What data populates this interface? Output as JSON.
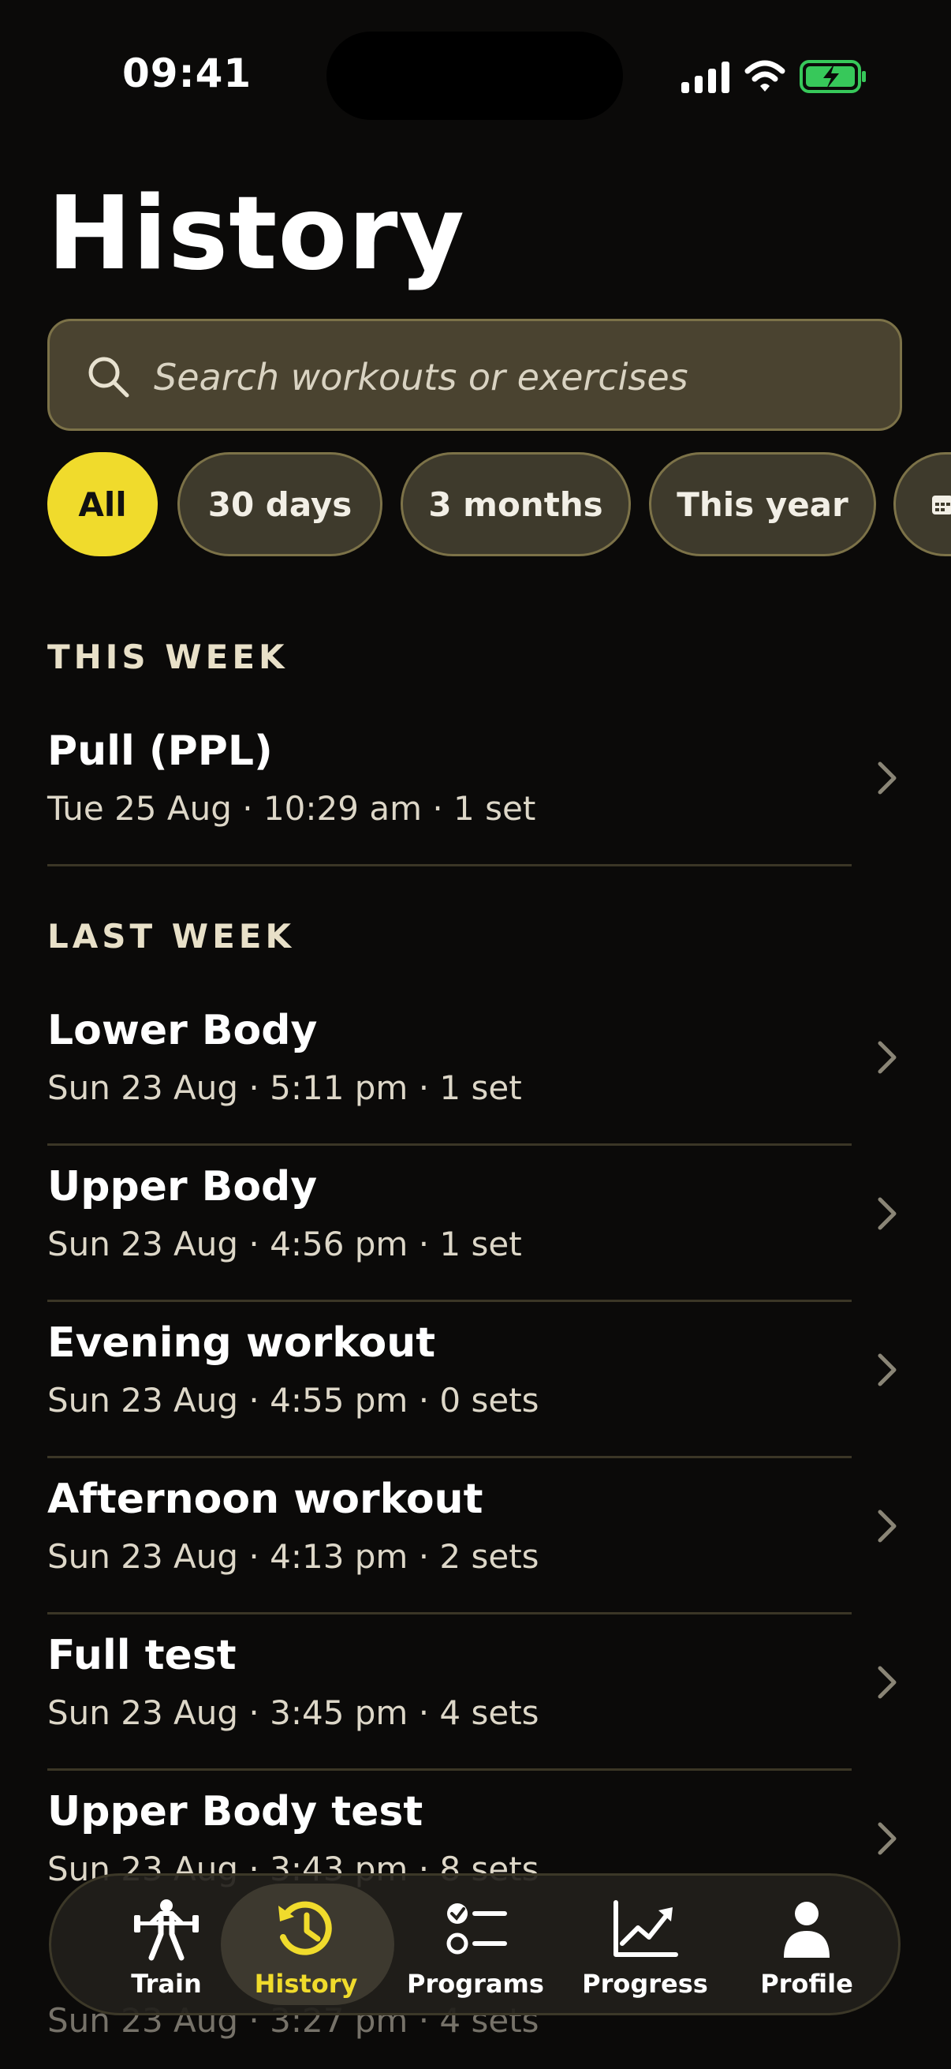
{
  "status_bar": {
    "time": "09:41"
  },
  "page": {
    "title": "History"
  },
  "search": {
    "placeholder": "Search workouts or exercises"
  },
  "filters": [
    {
      "label": "All",
      "active": true
    },
    {
      "label": "30 days",
      "active": false
    },
    {
      "label": "3 months",
      "active": false
    },
    {
      "label": "This year",
      "active": false
    }
  ],
  "sections": [
    {
      "heading": "THIS WEEK",
      "workouts": [
        {
          "name": "Pull (PPL)",
          "meta": "Tue 25 Aug  ·  10:29 am  ·  1 set"
        }
      ]
    },
    {
      "heading": "LAST WEEK",
      "workouts": [
        {
          "name": "Lower Body",
          "meta": "Sun 23 Aug  ·  5:11 pm  ·  1 set"
        },
        {
          "name": "Upper Body",
          "meta": "Sun 23 Aug  ·  4:56 pm  ·  1 set"
        },
        {
          "name": "Evening workout",
          "meta": "Sun 23 Aug  ·  4:55 pm  ·  0 sets"
        },
        {
          "name": "Afternoon workout",
          "meta": "Sun 23 Aug  ·  4:13 pm  ·  2 sets"
        },
        {
          "name": "Full test",
          "meta": "Sun 23 Aug  ·  3:45 pm  ·  4 sets"
        },
        {
          "name": "Upper Body test",
          "meta": "Sun 23 Aug  ·  3:43 pm  ·  8 sets"
        }
      ]
    }
  ],
  "partial_row": {
    "meta": "Sun 23 Aug  ·  3:27 pm  ·  4 sets"
  },
  "tabs": [
    {
      "label": "Train",
      "icon": "weightlifter-icon",
      "active": false
    },
    {
      "label": "History",
      "icon": "history-clock-icon",
      "active": true
    },
    {
      "label": "Programs",
      "icon": "checklist-icon",
      "active": false
    },
    {
      "label": "Progress",
      "icon": "trend-chart-icon",
      "active": false
    },
    {
      "label": "Profile",
      "icon": "person-icon",
      "active": false
    }
  ],
  "colors": {
    "accent": "#f0db2c",
    "background": "#0b0a09",
    "battery": "#37c85a"
  }
}
